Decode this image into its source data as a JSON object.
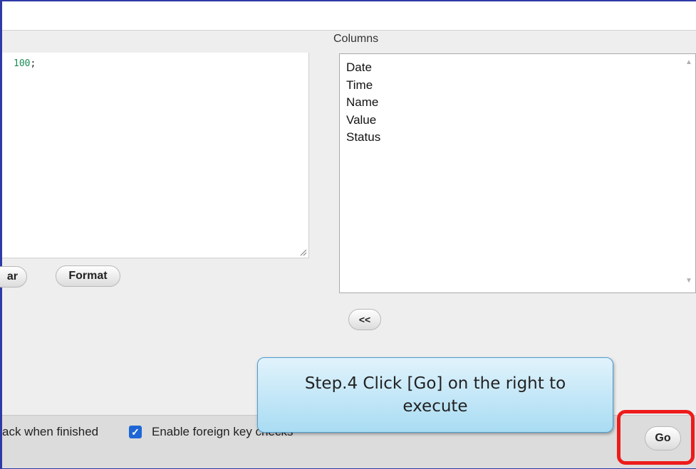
{
  "editor": {
    "query_fragment_number": "100",
    "query_fragment_end": ";"
  },
  "buttons": {
    "clear_label": "ar",
    "format_label": "Format",
    "move_label": "<<",
    "go_label": "Go"
  },
  "columns": {
    "label": "Columns",
    "items": [
      "Date",
      "Time",
      "Name",
      "Value",
      "Status"
    ]
  },
  "footer": {
    "rollback_text": "ack when finished",
    "foreign_key_text": "Enable foreign key checks",
    "foreign_key_checked": true
  },
  "annotation": {
    "callout_text": "Step.4 Click [Go] on the right to execute",
    "highlight_color": "#ee1b1b"
  },
  "colors": {
    "frame": "#2e3aa8",
    "checkbox": "#1e66d6",
    "callout_fill": "#a9dcf3"
  }
}
